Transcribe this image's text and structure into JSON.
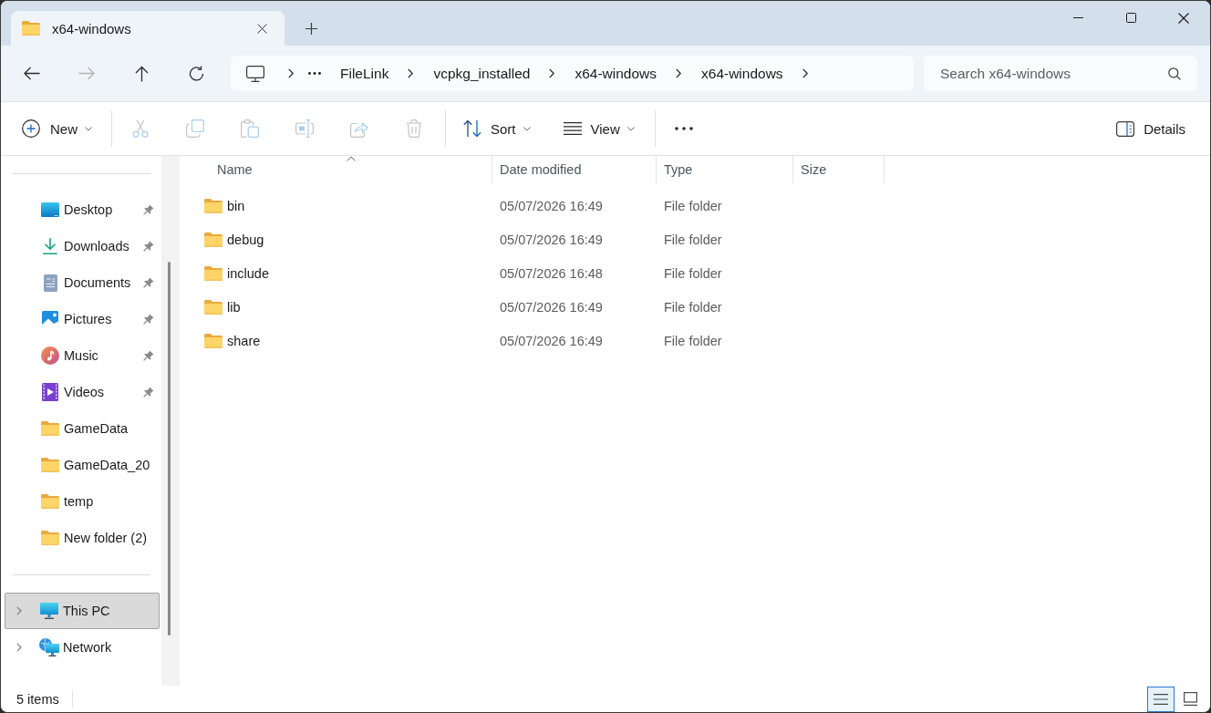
{
  "window": {
    "tabs": [
      {
        "label": "x64-windows",
        "selected": true
      }
    ]
  },
  "nav_buttons": [
    {
      "kind": "back",
      "disabled": false
    },
    {
      "kind": "forward",
      "disabled": true
    },
    {
      "kind": "up",
      "disabled": false
    },
    {
      "kind": "refresh",
      "disabled": false
    }
  ],
  "address_bar": {
    "breadcrumbs": [
      "FileLink",
      "vcpkg_installed",
      "x64-windows",
      "x64-windows"
    ]
  },
  "search": {
    "placeholder": "Search x64-windows"
  },
  "toolbar": {
    "groups": [
      [
        {
          "kind": "new",
          "label": "New",
          "disabled": false,
          "dropdown": true
        }
      ],
      [
        {
          "kind": "cut",
          "disabled": true,
          "dropdown": false
        },
        {
          "kind": "copy",
          "disabled": true,
          "dropdown": false
        },
        {
          "kind": "paste",
          "disabled": true,
          "dropdown": false
        },
        {
          "kind": "rename",
          "disabled": true,
          "dropdown": false
        },
        {
          "kind": "share",
          "disabled": true,
          "dropdown": false
        },
        {
          "kind": "delete",
          "disabled": true,
          "dropdown": false
        }
      ],
      [
        {
          "kind": "sort",
          "label": "Sort",
          "disabled": false,
          "dropdown": true
        },
        {
          "kind": "view",
          "label": "View",
          "disabled": false,
          "dropdown": true
        }
      ],
      [
        {
          "kind": "more",
          "disabled": false,
          "dropdown": false
        }
      ]
    ],
    "details": {
      "label": "Details"
    }
  },
  "sidebar": {
    "quick_access": [
      {
        "label": "Desktop",
        "kind": "desktop",
        "pinned": true,
        "selected": false
      },
      {
        "label": "Downloads",
        "kind": "downloads",
        "pinned": true,
        "selected": false
      },
      {
        "label": "Documents",
        "kind": "documents",
        "pinned": true,
        "selected": false
      },
      {
        "label": "Pictures",
        "kind": "pictures",
        "pinned": true,
        "selected": false
      },
      {
        "label": "Music",
        "kind": "music",
        "pinned": true,
        "selected": false
      },
      {
        "label": "Videos",
        "kind": "videos",
        "pinned": true,
        "selected": false
      },
      {
        "label": "GameData",
        "kind": "folder",
        "pinned": false,
        "selected": false
      },
      {
        "label": "GameData_20",
        "kind": "folder",
        "pinned": false,
        "selected": false
      },
      {
        "label": "temp",
        "kind": "folder",
        "pinned": false,
        "selected": false
      },
      {
        "label": "New folder (2)",
        "kind": "folder",
        "pinned": false,
        "selected": false
      }
    ],
    "locations": [
      {
        "label": "This PC",
        "kind": "pc",
        "selected": true,
        "expanded": false
      },
      {
        "label": "Network",
        "kind": "network",
        "selected": false,
        "expanded": false
      }
    ]
  },
  "table": {
    "columns": [
      {
        "label": "Name",
        "sorted": true
      },
      {
        "label": "Date modified",
        "sorted": false
      },
      {
        "label": "Type",
        "sorted": false
      },
      {
        "label": "Size",
        "sorted": false
      }
    ],
    "rows": [
      {
        "name": "bin",
        "date_modified": "05/07/2026 16:49",
        "type": "File folder",
        "selected": false
      },
      {
        "name": "debug",
        "date_modified": "05/07/2026 16:49",
        "type": "File folder",
        "selected": false
      },
      {
        "name": "include",
        "date_modified": "05/07/2026 16:48",
        "type": "File folder",
        "selected": false
      },
      {
        "name": "lib",
        "date_modified": "05/07/2026 16:49",
        "type": "File folder",
        "selected": false
      },
      {
        "name": "share",
        "date_modified": "05/07/2026 16:49",
        "type": "File folder",
        "selected": false
      }
    ]
  },
  "status_bar": {
    "item_count": "5 items",
    "view_modes": [
      {
        "kind": "details",
        "selected": true
      },
      {
        "kind": "tiles",
        "selected": false
      }
    ]
  }
}
